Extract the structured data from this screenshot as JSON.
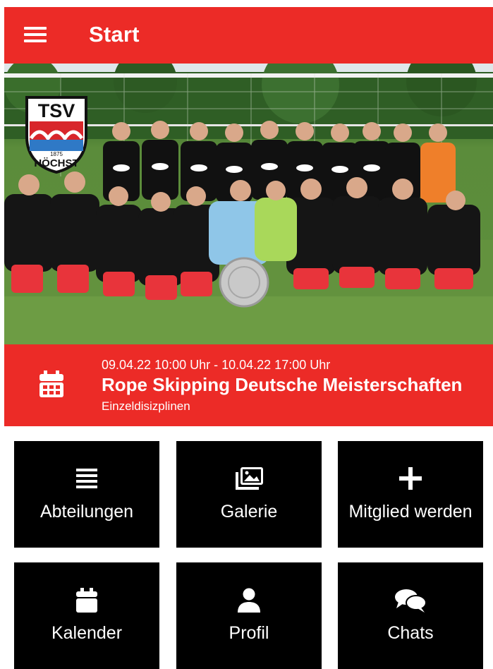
{
  "app": {
    "title": "Start"
  },
  "hero": {
    "image": "team-photo",
    "logo_text": "TSV",
    "logo_sub": "HÖCHST",
    "logo_year": "1875"
  },
  "event": {
    "date_range": "09.04.22 10:00 Uhr - 10.04.22 17:00 Uhr",
    "name": "Rope Skipping Deutsche Meisterschaften",
    "subtitle": "Einzeldisizplinen",
    "icon": "calendar-icon"
  },
  "tiles": [
    {
      "label": "Abteilungen",
      "icon": "list-icon"
    },
    {
      "label": "Galerie",
      "icon": "gallery-icon"
    },
    {
      "label": "Mitglied werden",
      "icon": "plus-icon"
    },
    {
      "label": "Kalender",
      "icon": "calendar-icon"
    },
    {
      "label": "Profil",
      "icon": "user-icon"
    },
    {
      "label": "Chats",
      "icon": "chats-icon"
    }
  ],
  "colors": {
    "accent": "#ec2b27",
    "tile": "#000000"
  }
}
